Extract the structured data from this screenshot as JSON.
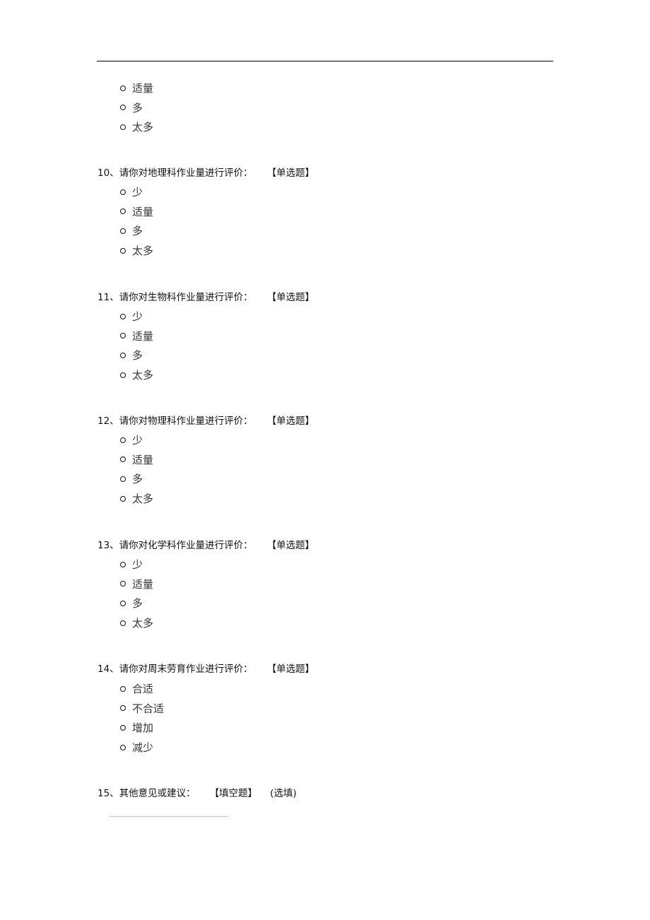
{
  "continued_options": [
    "适量",
    "多",
    "太多"
  ],
  "questions": [
    {
      "number": "10、",
      "text": "请你对地理科作业量进行评价：",
      "type": "【单选题】",
      "options": [
        "少",
        "适量",
        "多",
        "太多"
      ]
    },
    {
      "number": "11、",
      "text": "请你对生物科作业量进行评价：",
      "type": "【单选题】",
      "options": [
        "少",
        "适量",
        "多",
        "太多"
      ]
    },
    {
      "number": "12、",
      "text": "请你对物理科作业量进行评价：",
      "type": "【单选题】",
      "options": [
        "少",
        "适量",
        "多",
        "太多"
      ]
    },
    {
      "number": "13、",
      "text": "请你对化学科作业量进行评价：",
      "type": "【单选题】",
      "options": [
        "少",
        "适量",
        "多",
        "太多"
      ]
    },
    {
      "number": "14、",
      "text": "请你对周末劳育作业进行评价：",
      "type": "【单选题】",
      "options": [
        "合适",
        "不合适",
        "增加",
        "减少"
      ]
    },
    {
      "number": "15、",
      "text": "其他意见或建议：",
      "type": "【填空题】",
      "optional": "(选填)"
    }
  ]
}
